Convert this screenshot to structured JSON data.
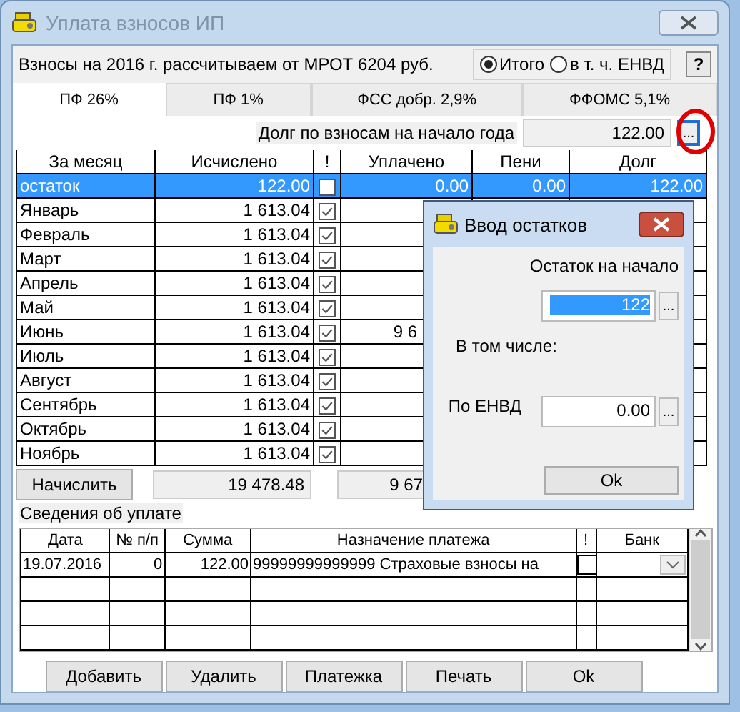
{
  "window": {
    "title": "Уплата взносов ИП",
    "active": false
  },
  "header": {
    "text": "Взносы на 2016 г. рассчитываем от МРОТ 6204 руб.",
    "radios": [
      {
        "label": "Итого",
        "selected": true
      },
      {
        "label": "в т. ч. ЕНВД",
        "selected": false
      }
    ],
    "help": "?"
  },
  "tabs": [
    {
      "label": "ПФ 26%",
      "selected": true
    },
    {
      "label": "ПФ 1%",
      "selected": false
    },
    {
      "label": "ФСС добр. 2,9%",
      "selected": false
    },
    {
      "label": "ФФОМС 5,1%",
      "selected": false
    }
  ],
  "debt": {
    "label": "Долг по взносам на начало года",
    "value": "122.00",
    "button": "..."
  },
  "grid": {
    "columns": [
      "За месяц",
      "Исчислено",
      "!",
      "Уплачено",
      "Пени",
      "Долг"
    ],
    "rows": [
      {
        "month": "остаток",
        "calculated": "122.00",
        "flag": false,
        "paid": "0.00",
        "penalty": "0.00",
        "debt": "122.00",
        "selected": true
      },
      {
        "month": "Январь",
        "calculated": "1 613.04",
        "flag": true,
        "selected": false
      },
      {
        "month": "Февраль",
        "calculated": "1 613.04",
        "flag": true,
        "selected": false
      },
      {
        "month": "Март",
        "calculated": "1 613.04",
        "flag": true,
        "selected": false
      },
      {
        "month": "Апрель",
        "calculated": "1 613.04",
        "flag": true,
        "selected": false
      },
      {
        "month": "Май",
        "calculated": "1 613.04",
        "flag": true,
        "selected": false
      },
      {
        "month": "Июнь",
        "calculated": "1 613.04",
        "flag": true,
        "paid": "9 6",
        "selected": false
      },
      {
        "month": "Июль",
        "calculated": "1 613.04",
        "flag": true,
        "selected": false
      },
      {
        "month": "Август",
        "calculated": "1 613.04",
        "flag": true,
        "selected": false
      },
      {
        "month": "Сентябрь",
        "calculated": "1 613.04",
        "flag": true,
        "selected": false
      },
      {
        "month": "Октябрь",
        "calculated": "1 613.04",
        "flag": true,
        "selected": false
      },
      {
        "month": "Ноябрь",
        "calculated": "1 613.04",
        "flag": true,
        "selected": false
      }
    ]
  },
  "totals": {
    "button": "Начислить",
    "calculated": "19 478.48",
    "paid": "9 67"
  },
  "payments": {
    "title": "Сведения об уплате",
    "columns": [
      "Дата",
      "№ п/п",
      "Сумма",
      "Назначение платежа",
      "!",
      "Банк"
    ],
    "rows": [
      {
        "date": "19.07.2016",
        "number": "0",
        "amount": "122.00",
        "purpose": "99999999999999 Страховые взносы на",
        "flag": false
      }
    ]
  },
  "buttons": [
    "Добавить",
    "Удалить",
    "Платежка",
    "Печать",
    "Ok"
  ],
  "dialog": {
    "title": "Ввод остатков",
    "start_label": "Остаток на начало",
    "start_value": "122",
    "start_value_selected": true,
    "start_button": "...",
    "subtitle": "В том числе:",
    "envd_label": "По ЕНВД",
    "envd_value": "0.00",
    "envd_button": "...",
    "ok": "Ok"
  }
}
